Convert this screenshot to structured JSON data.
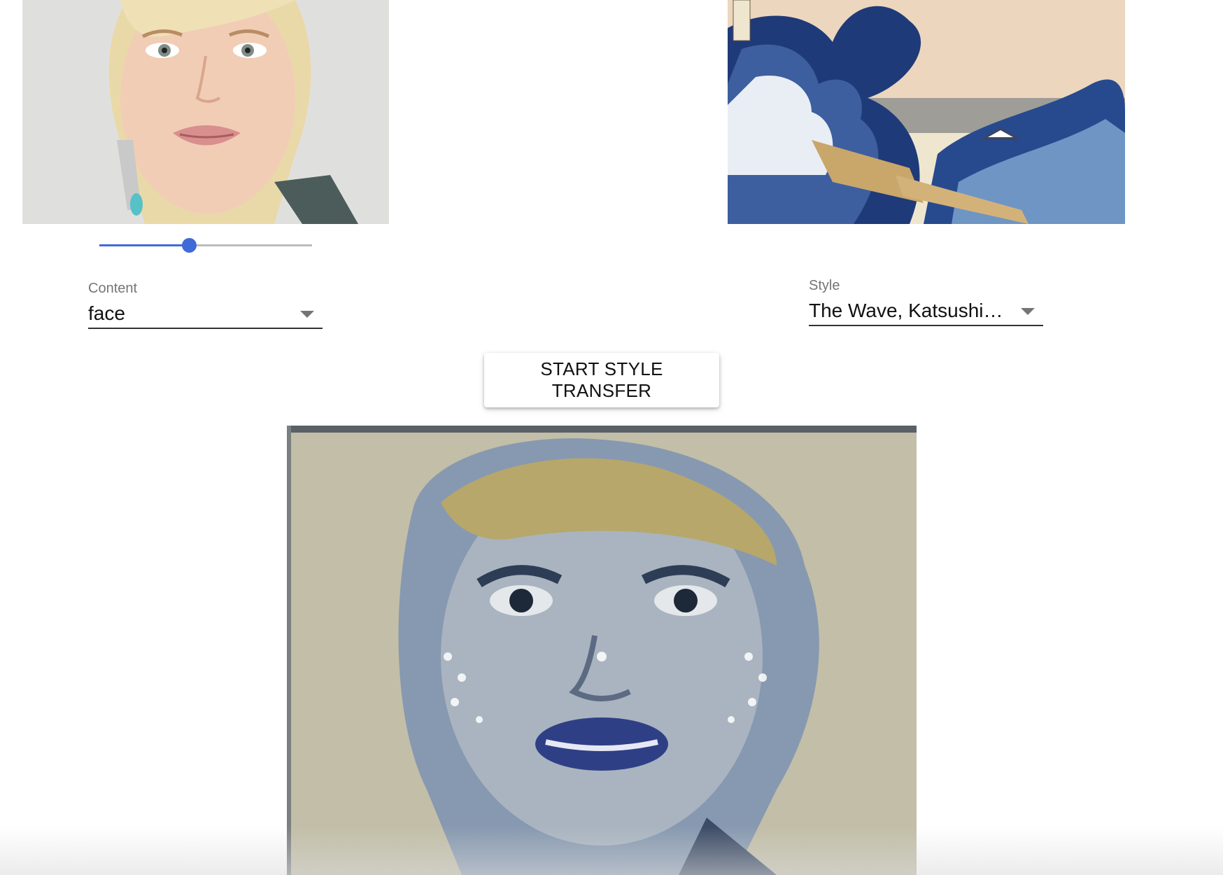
{
  "content_select": {
    "label": "Content",
    "value": "face"
  },
  "style_select": {
    "label": "Style",
    "value": "The Wave, Katsushika Hokusai"
  },
  "style_strength_slider": {
    "value_fraction": 0.42
  },
  "actions": {
    "start_label": "START STYLE TRANSFER"
  },
  "colors": {
    "accent": "#3f6ad8",
    "underline": "#333333",
    "label": "#757575"
  }
}
